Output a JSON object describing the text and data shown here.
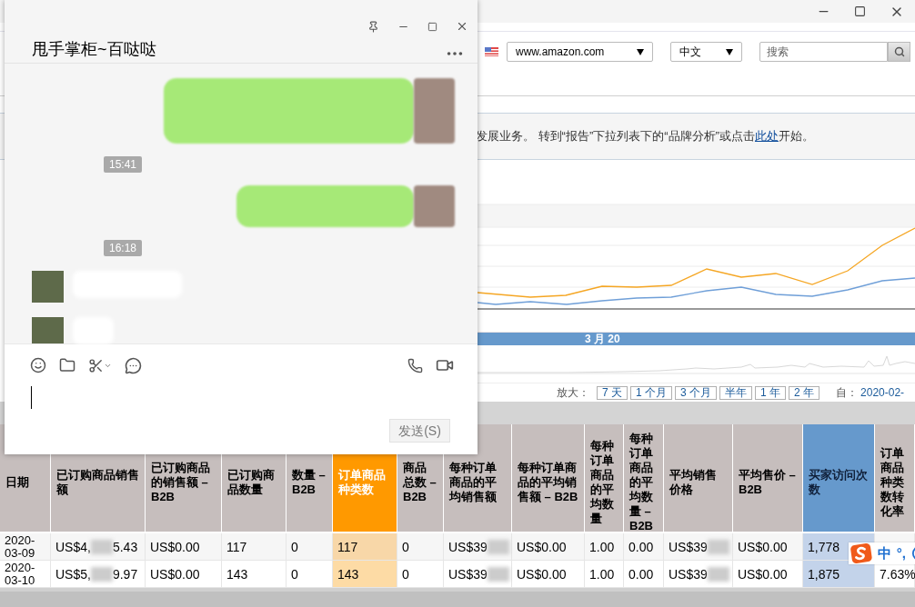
{
  "browser": {
    "toolbar": {
      "site": "www.amazon.com",
      "language": "中文",
      "search": {
        "placeholder": "搜索"
      }
    },
    "notice": {
      "text": "发展业务。 转到“报告”下拉列表下的“品牌分析”或点击",
      "link": "此处",
      "after": "开始。"
    },
    "chart": {
      "navigator_label": "3 月 20"
    },
    "zoom": {
      "label": "放大：",
      "buttons": [
        "7 天",
        "1 个月",
        "3 个月",
        "半年",
        "1 年",
        "2 年"
      ],
      "from_label": "自：",
      "from_value": "2020-02-"
    },
    "table": {
      "columns": [
        {
          "label": "日期",
          "kind": "plain"
        },
        {
          "label": "已订购商品销售额",
          "kind": "plain"
        },
        {
          "label": "已订购商品的销售额 – B2B",
          "kind": "plain"
        },
        {
          "label": "已订购商品数量",
          "kind": "plain"
        },
        {
          "label": "数量 – B2B",
          "kind": "plain"
        },
        {
          "label": "订单商品种类数",
          "kind": "primary"
        },
        {
          "label": "商品总数 – B2B",
          "kind": "plain"
        },
        {
          "label": "每种订单商品的平均销售额",
          "kind": "plain"
        },
        {
          "label": "每种订单商品的平均销售额 – B2B",
          "kind": "plain"
        },
        {
          "label": "每种订单商品的平均数量",
          "kind": "plain"
        },
        {
          "label": "每种订单商品的平均数量 – B2B",
          "kind": "plain"
        },
        {
          "label": "平均销售价格",
          "kind": "plain"
        },
        {
          "label": "平均售价 – B2B",
          "kind": "plain"
        },
        {
          "label": "买家访问次数",
          "kind": "secondary"
        },
        {
          "label": "订单商品种类数转化率",
          "kind": "plain"
        }
      ],
      "rows": [
        {
          "cells": [
            {
              "text": "2020-03-09",
              "blurred": false
            },
            {
              "text": "US$4,",
              "blurred": true,
              "after": "5.43"
            },
            {
              "text": "US$0.00",
              "blurred": false
            },
            {
              "text": "117",
              "blurred": false
            },
            {
              "text": "0",
              "blurred": false
            },
            {
              "text": "117",
              "blurred": false
            },
            {
              "text": "0",
              "blurred": false
            },
            {
              "text": "US$39",
              "blurred": true
            },
            {
              "text": "US$0.00",
              "blurred": false
            },
            {
              "text": "1.00",
              "blurred": false
            },
            {
              "text": "0.00",
              "blurred": false
            },
            {
              "text": "US$39",
              "blurred": true
            },
            {
              "text": "US$0.00",
              "blurred": false
            },
            {
              "text": "1,778",
              "blurred": false
            }
          ]
        },
        {
          "cells": [
            {
              "text": "2020-03-10",
              "blurred": false
            },
            {
              "text": "US$5,",
              "blurred": true,
              "after": "9.97"
            },
            {
              "text": "US$0.00",
              "blurred": false
            },
            {
              "text": "143",
              "blurred": false
            },
            {
              "text": "0",
              "blurred": false
            },
            {
              "text": "143",
              "blurred": false
            },
            {
              "text": "0",
              "blurred": false
            },
            {
              "text": "US$39",
              "blurred": true
            },
            {
              "text": "US$0.00",
              "blurred": false
            },
            {
              "text": "1.00",
              "blurred": false
            },
            {
              "text": "0.00",
              "blurred": false
            },
            {
              "text": "US$39",
              "blurred": true
            },
            {
              "text": "US$0.00",
              "blurred": false
            },
            {
              "text": "1,875",
              "blurred": false
            },
            {
              "text": "7.63%",
              "blurred": false
            }
          ]
        }
      ]
    }
  },
  "chat": {
    "title": "甩手掌柜~百哒哒",
    "messages": [
      {
        "kind": "sent"
      },
      {
        "kind": "time",
        "text": "15:41"
      },
      {
        "kind": "sent"
      },
      {
        "kind": "time",
        "text": "16:18"
      },
      {
        "kind": "received"
      },
      {
        "kind": "received"
      }
    ],
    "send_button": "发送(S)"
  },
  "ime": {
    "mode": "中",
    "punctuation": "°,"
  }
}
